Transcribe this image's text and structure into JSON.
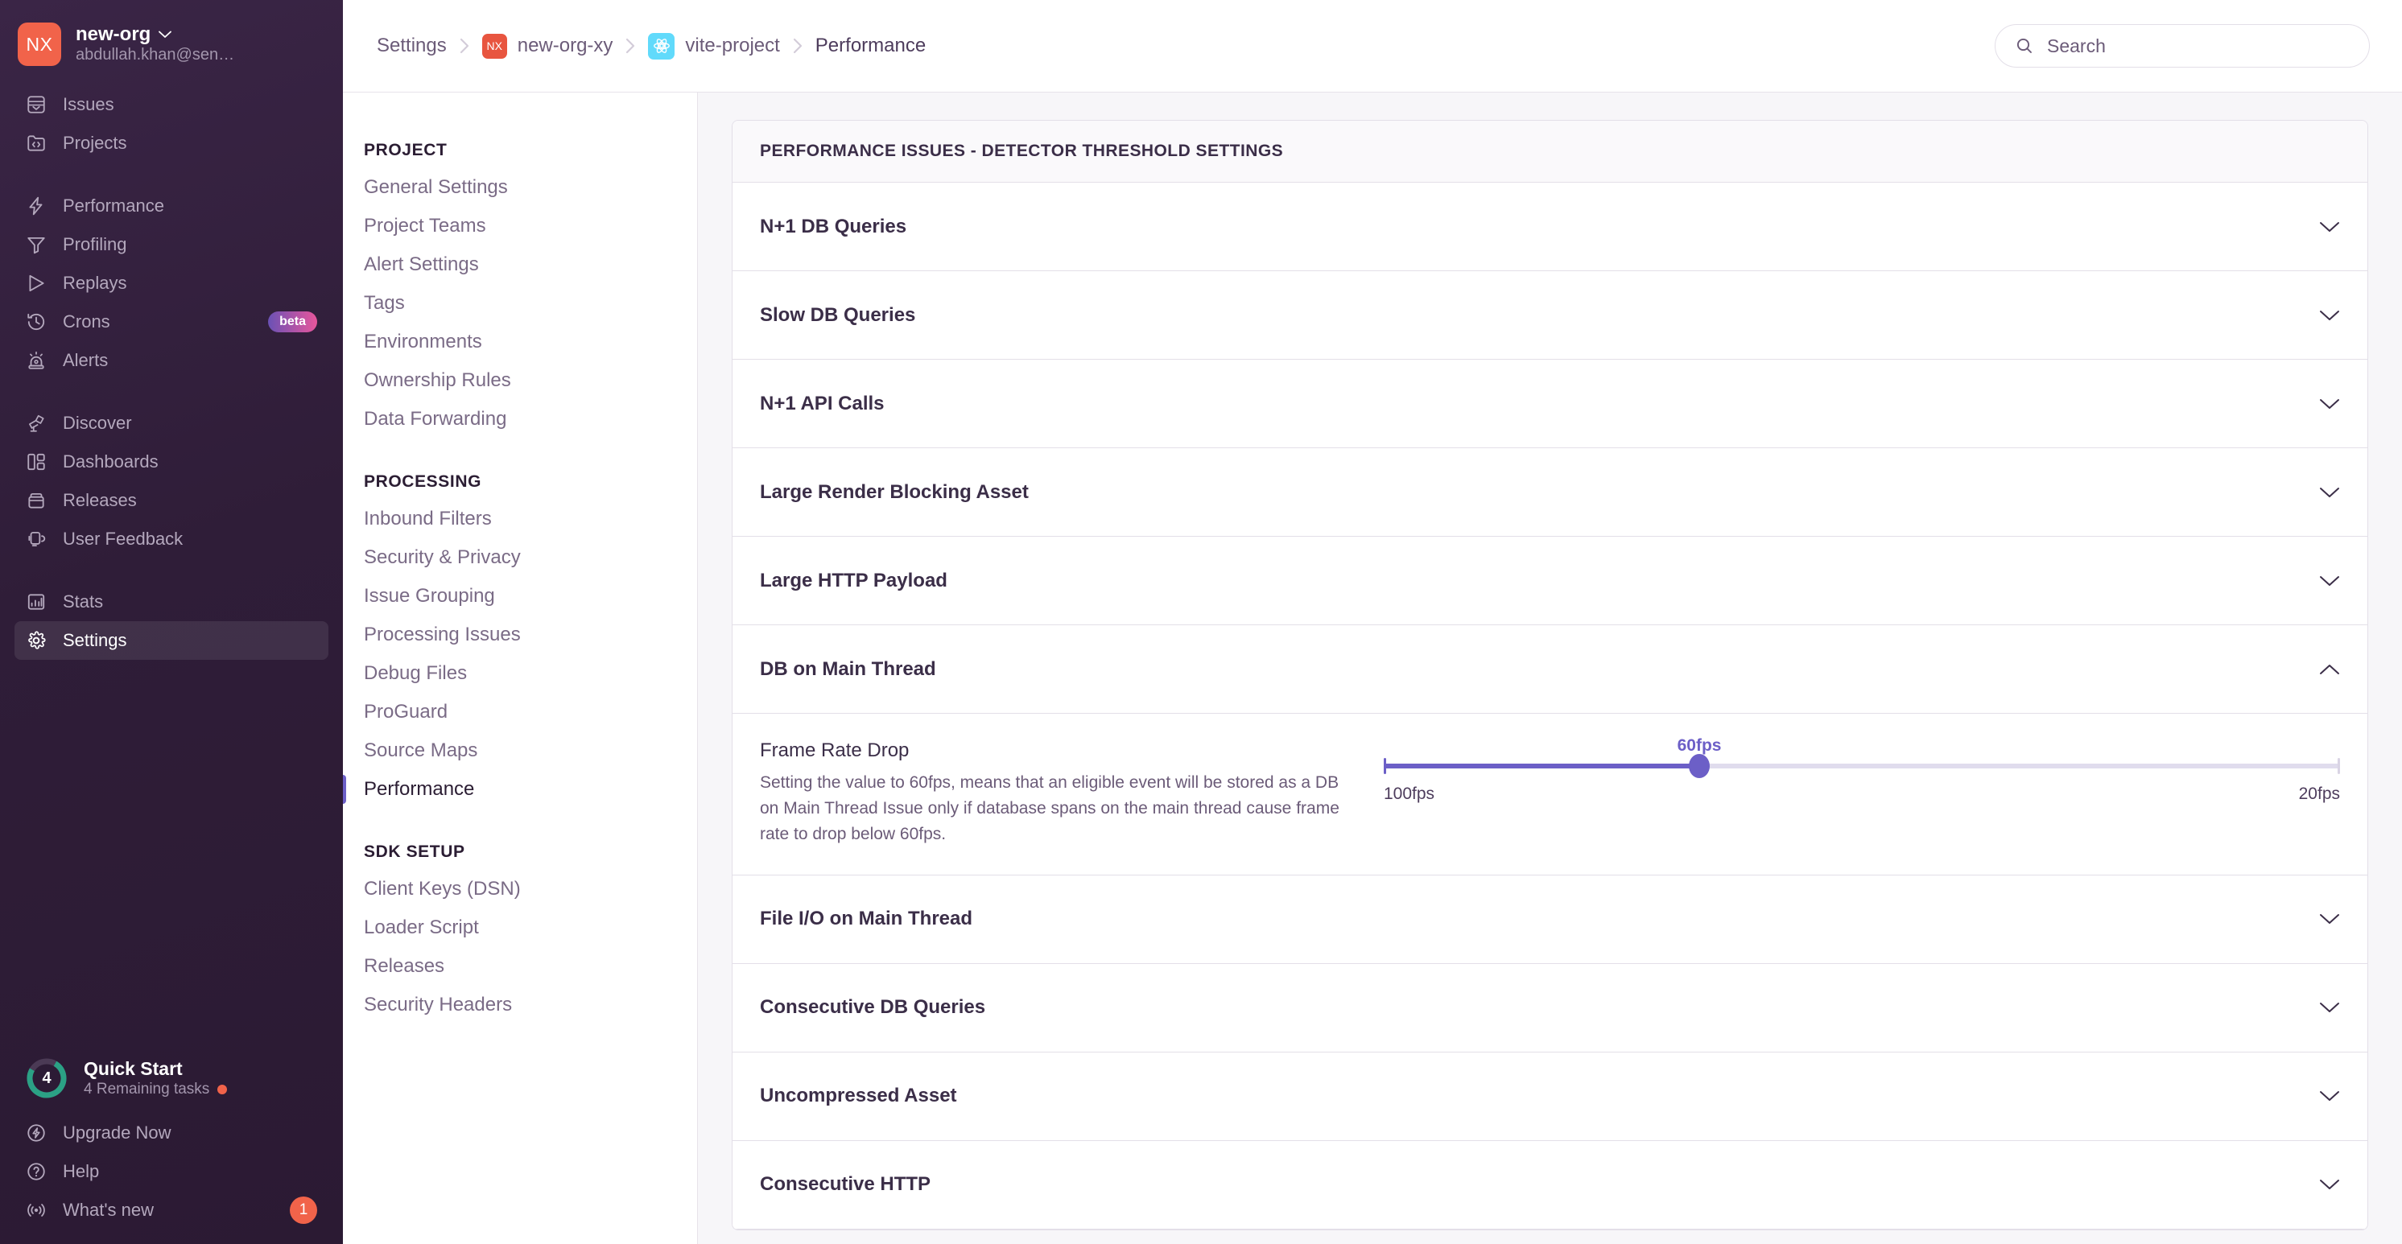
{
  "sidebar": {
    "org": {
      "avatar_text": "NX",
      "name": "new-org",
      "email": "abdullah.khan@sen…"
    },
    "groups": [
      {
        "items": [
          {
            "label": "Issues",
            "icon": "issues-icon"
          },
          {
            "label": "Projects",
            "icon": "projects-icon"
          }
        ]
      },
      {
        "items": [
          {
            "label": "Performance",
            "icon": "lightning-icon"
          },
          {
            "label": "Profiling",
            "icon": "profiling-icon"
          },
          {
            "label": "Replays",
            "icon": "play-icon"
          },
          {
            "label": "Crons",
            "icon": "clock-history-icon",
            "badge": "beta"
          },
          {
            "label": "Alerts",
            "icon": "siren-icon"
          }
        ]
      },
      {
        "items": [
          {
            "label": "Discover",
            "icon": "telescope-icon"
          },
          {
            "label": "Dashboards",
            "icon": "dashboards-icon"
          },
          {
            "label": "Releases",
            "icon": "releases-icon"
          },
          {
            "label": "User Feedback",
            "icon": "headset-icon"
          }
        ]
      },
      {
        "items": [
          {
            "label": "Stats",
            "icon": "bar-chart-icon"
          },
          {
            "label": "Settings",
            "icon": "gear-icon",
            "active": true
          }
        ]
      }
    ],
    "quick_start": {
      "progress_number": "4",
      "title": "Quick Start",
      "subtitle": "4 Remaining tasks"
    },
    "footer_items": [
      {
        "label": "Upgrade Now",
        "icon": "zap-circle-icon"
      },
      {
        "label": "Help",
        "icon": "question-circle-icon"
      },
      {
        "label": "What's new",
        "icon": "broadcast-icon",
        "count": "1"
      }
    ]
  },
  "topbar": {
    "breadcrumbs": [
      {
        "label": "Settings",
        "icon": null
      },
      {
        "label": "new-org-xy",
        "icon": "nx-org-avatar",
        "icon_text": "NX"
      },
      {
        "label": "vite-project",
        "icon": "react-platform-icon"
      },
      {
        "label": "Performance",
        "icon": null
      }
    ],
    "search": {
      "placeholder": "Search",
      "icon": "search-icon"
    }
  },
  "settings_nav": {
    "sections": [
      {
        "heading": "PROJECT",
        "items": [
          {
            "label": "General Settings"
          },
          {
            "label": "Project Teams"
          },
          {
            "label": "Alert Settings"
          },
          {
            "label": "Tags"
          },
          {
            "label": "Environments"
          },
          {
            "label": "Ownership Rules"
          },
          {
            "label": "Data Forwarding"
          }
        ]
      },
      {
        "heading": "PROCESSING",
        "items": [
          {
            "label": "Inbound Filters"
          },
          {
            "label": "Security & Privacy"
          },
          {
            "label": "Issue Grouping"
          },
          {
            "label": "Processing Issues"
          },
          {
            "label": "Debug Files"
          },
          {
            "label": "ProGuard"
          },
          {
            "label": "Source Maps"
          },
          {
            "label": "Performance",
            "active": true
          }
        ]
      },
      {
        "heading": "SDK SETUP",
        "items": [
          {
            "label": "Client Keys (DSN)"
          },
          {
            "label": "Loader Script"
          },
          {
            "label": "Releases"
          },
          {
            "label": "Security Headers"
          }
        ]
      }
    ]
  },
  "main": {
    "panel_title": "PERFORMANCE ISSUES - DETECTOR THRESHOLD SETTINGS",
    "rows": [
      {
        "title": "N+1 DB Queries",
        "expanded": false
      },
      {
        "title": "Slow DB Queries",
        "expanded": false
      },
      {
        "title": "N+1 API Calls",
        "expanded": false
      },
      {
        "title": "Large Render Blocking Asset",
        "expanded": false
      },
      {
        "title": "Large HTTP Payload",
        "expanded": false
      },
      {
        "title": "DB on Main Thread",
        "expanded": true
      },
      {
        "title": "File I/O on Main Thread",
        "expanded": false
      },
      {
        "title": "Consecutive DB Queries",
        "expanded": false
      },
      {
        "title": "Uncompressed Asset",
        "expanded": false
      },
      {
        "title": "Consecutive HTTP",
        "expanded": false
      }
    ],
    "detail": {
      "title": "Frame Rate Drop",
      "description": "Setting the value to 60fps, means that an eligible event will be stored as a DB on Main Thread Issue only if database spans on the main thread cause frame rate to drop below 60fps.",
      "slider": {
        "value_label": "60fps",
        "min_label": "100fps",
        "max_label": "20fps",
        "fill_percent": 33
      }
    }
  },
  "colors": {
    "accent_purple": "#6c5fc7",
    "brand_orange": "#f1634a",
    "sidebar_bg": "#2f1d38",
    "react_blue": "#61dafb",
    "progress_green": "#2ba185"
  }
}
